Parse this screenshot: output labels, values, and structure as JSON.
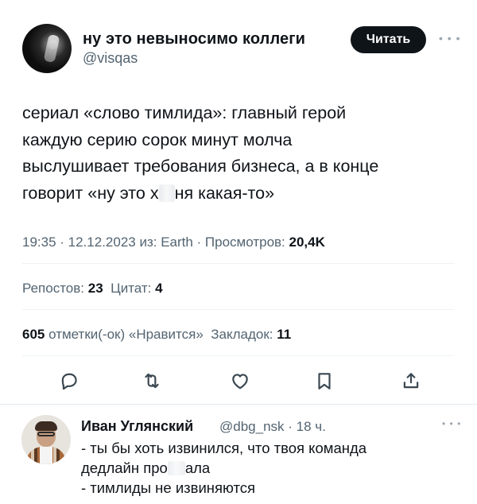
{
  "tweet": {
    "display_name": "ну это невыносимо коллеги",
    "handle": "@visqas",
    "follow_label": "Читать",
    "more_icon": "more-horizontal-icon",
    "text_lines": [
      "сериал «слово тимлида»: главный герой",
      "каждую серию сорок минут молча",
      "выслушивает требования бизнеса, а в конце"
    ],
    "last_line_before": "говорит «ну это х",
    "last_line_after": "ня какая-то»",
    "meta_text": "19:35 · 12.12.2023 из: Earth · Просмотров: ",
    "views": "20,4K"
  },
  "stats": {
    "reposts_label": "Репостов:",
    "reposts": "23",
    "quotes_label": "Цитат:",
    "quotes": "4",
    "likes": "605",
    "likes_label": "отметки(-ок) «Нравится»",
    "bookmarks_label": "Закладок:",
    "bookmarks": "11"
  },
  "actions": {
    "reply_icon": "reply-icon",
    "retweet_icon": "retweet-icon",
    "like_icon": "heart-icon",
    "bookmark_icon": "bookmark-icon",
    "share_icon": "share-icon"
  },
  "reply": {
    "display_name": "Иван Углянский",
    "handle_time": "@dbg_nsk · 18 ч.",
    "line1": "- ты бы хоть извинился, что твоя команда",
    "line2_before": "дедлайн про",
    "line2_after": "ала",
    "line3": "- тимлиды не извиняются"
  },
  "colors": {
    "text": "#0f1419",
    "secondary": "#536471",
    "button_bg": "#0f1419",
    "divider": "#eff3f4"
  }
}
